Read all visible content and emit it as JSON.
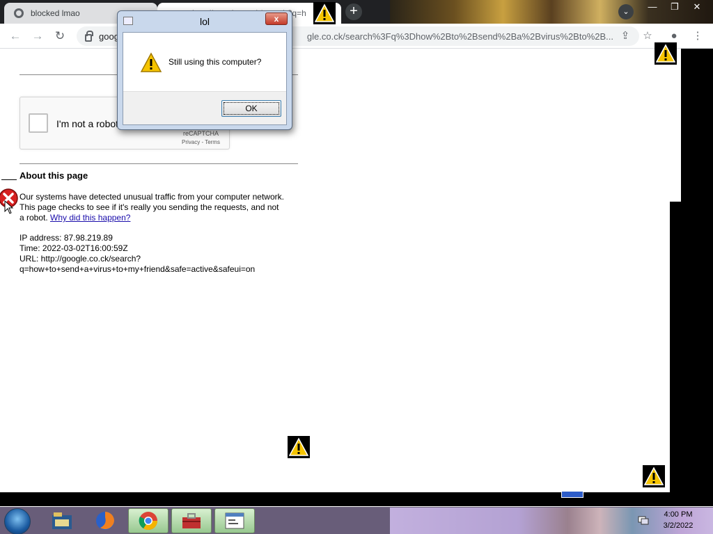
{
  "browser": {
    "tab1_title": "blocked lmao",
    "tab2_title": "http://google.co.ck/search?q=h",
    "url_host": "goog",
    "url_rest": "gle.co.ck/search%3Fq%3Dhow%2Bto%2Bsend%2Ba%2Bvirus%2Bto%2B...",
    "new_tab": "+",
    "win_min": "—",
    "win_max": "❐",
    "win_close": "✕"
  },
  "recaptcha": {
    "label": "I'm not a robot",
    "brand": "reCAPTCHA",
    "links": "Privacy - Terms"
  },
  "about": {
    "title": "About this page",
    "body_pre": "Our systems have detected unusual traffic from your computer network. This page checks to see if it's really you sending the requests, and not a robot. ",
    "link": "Why did this happen?",
    "ip": "IP address: 87.98.219.89",
    "time": "Time: 2022-03-02T16:00:59Z",
    "url_line1": "URL: http://google.co.ck/search?",
    "url_line2": "q=how+to+send+a+virus+to+my+friend&safe=active&safeui=on"
  },
  "dialog": {
    "title": "lol",
    "message": "Still using this computer?",
    "ok_label": "OK",
    "close_label": "x"
  },
  "taskbar": {
    "time": "4:00 PM",
    "date": "3/2/2022"
  },
  "colors": {
    "link": "#1a0dab",
    "warning_yellow": "#f5c400",
    "error_red": "#d62020"
  }
}
